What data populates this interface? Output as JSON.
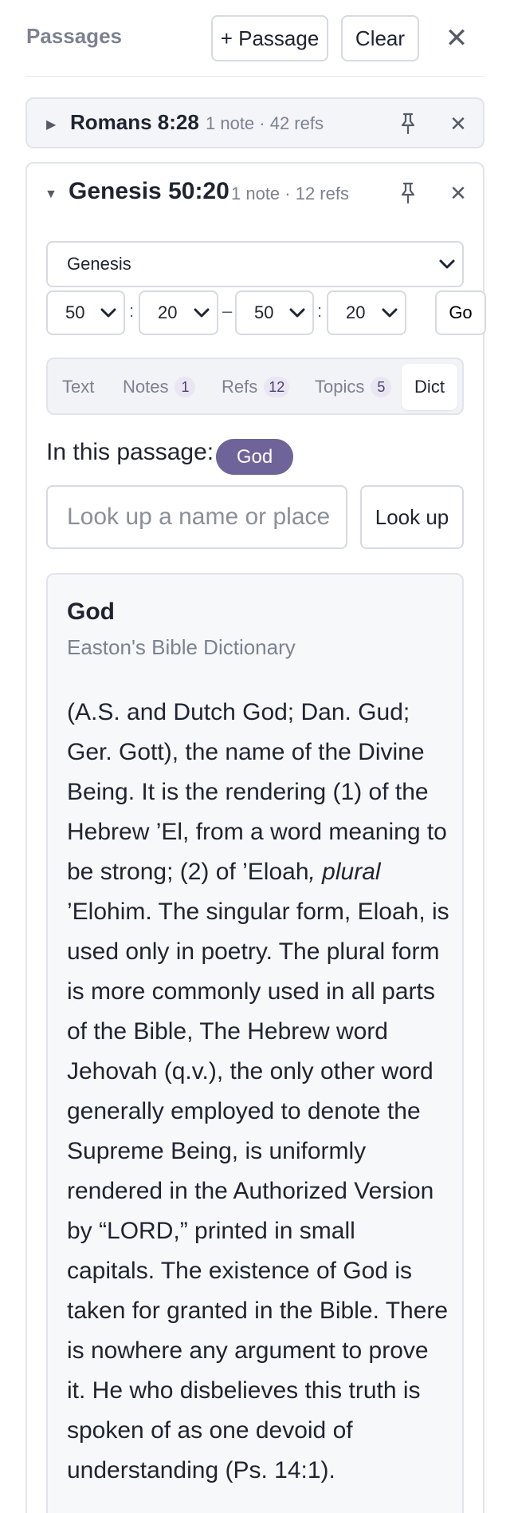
{
  "header": {
    "title": "Passages",
    "add_button": "+ Passage",
    "clear_button": "Clear",
    "close": "✕"
  },
  "passages": [
    {
      "ref": "Romans 8:28",
      "meta": "1 note · 42 refs",
      "expanded": false,
      "caret": "▶",
      "close": "✕"
    },
    {
      "ref": "Genesis 50:20",
      "meta": "1 note · 12 refs",
      "expanded": true,
      "caret": "▼",
      "close": "✕",
      "book": "Genesis",
      "range": {
        "from_chapter": "50",
        "from_verse": "20",
        "to_chapter": "50",
        "to_verse": "20",
        "colon": ":",
        "dash": "–"
      },
      "go_button": "Go",
      "tabs": [
        {
          "label": "Text",
          "count": null,
          "active": false
        },
        {
          "label": "Notes",
          "count": "1",
          "active": false
        },
        {
          "label": "Refs",
          "count": "12",
          "active": false
        },
        {
          "label": "Topics",
          "count": "5",
          "active": false
        },
        {
          "label": "Dict",
          "count": null,
          "active": true
        }
      ],
      "in_passage_label": "In this passage:",
      "in_passage_chip": "God",
      "lookup": {
        "placeholder": "Look up a name or place",
        "value": "",
        "button": "Look up"
      },
      "entry": {
        "term": "God",
        "source": "Easton's Bible Dictionary",
        "body_before": "(A.S. and Dutch God; Dan. Gud; Ger. Gott), the name of the Divine Being. It is the rendering (1) of the Hebrew ’El, from a word meaning to be strong; (2) of ’Eloah",
        "body_italic": ", plural",
        "body_after": " ’Elohim. The singular form, Eloah, is used only in poetry. The plural form is more commonly used in all parts of the Bible, The Hebrew word Jehovah (q.v.), the only other word generally employed to denote the Supreme Being, is uniformly rendered in the Authorized Version by “LORD,” printed in small capitals. The existence of God is taken for granted in the Bible. There is nowhere any argument to prove it. He who disbelieves this truth is spoken of as one devoid of understanding (Ps. 14:1)."
      }
    }
  ],
  "colors": {
    "accent": "#6f6499",
    "badge_bg": "#e9e6f2",
    "muted_text": "#7c8290",
    "border": "#d7dae2"
  },
  "icons": {
    "pin": "pin-icon",
    "close": "close-icon",
    "caret_right": "caret-right-icon",
    "caret_down": "caret-down-icon",
    "chevron_down": "chevron-down-icon"
  }
}
